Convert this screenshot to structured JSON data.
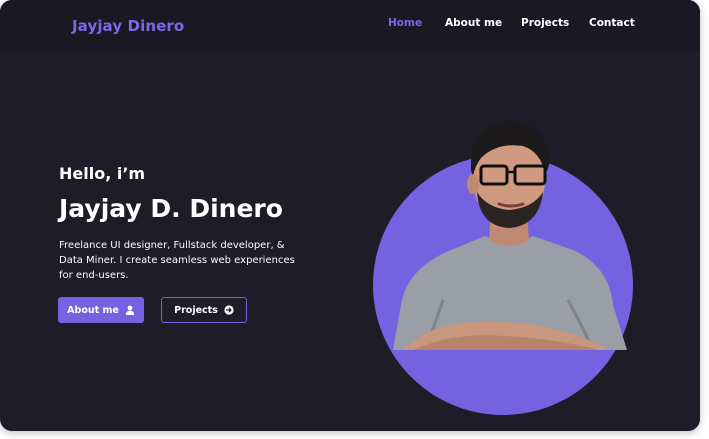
{
  "nav": {
    "brand": "Jayjay Dinero",
    "links": [
      {
        "label": "Home",
        "active": true
      },
      {
        "label": "About me",
        "active": false
      },
      {
        "label": "Projects",
        "active": false
      },
      {
        "label": "Contact",
        "active": false
      }
    ]
  },
  "hero": {
    "greeting": "Hello, i’m",
    "name": "Jayjay D. Dinero",
    "description": "Freelance UI designer, Fullstack developer, & Data Miner. I create seamless web experiences for end-users.",
    "buttons": {
      "about_label": "About me",
      "about_icon": "user-icon",
      "projects_label": "Projects",
      "projects_icon": "arrow-circle-icon"
    },
    "portrait_icon": "person-portrait"
  },
  "colors": {
    "accent": "#7462e0",
    "background": "#1d1c27",
    "text": "#ffffff"
  }
}
